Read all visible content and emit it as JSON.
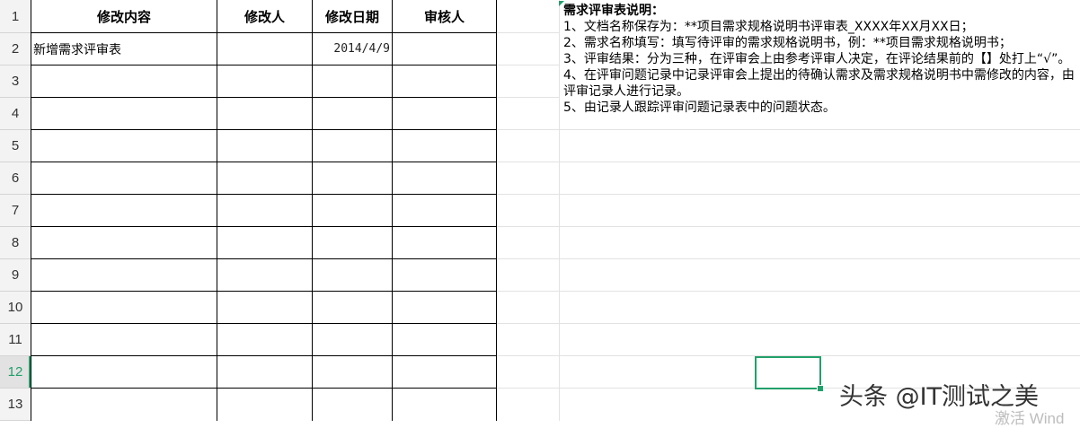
{
  "row_numbers": [
    "1",
    "2",
    "3",
    "4",
    "5",
    "6",
    "7",
    "8",
    "9",
    "10",
    "11",
    "12",
    "13"
  ],
  "active_row": "12",
  "table": {
    "headers": [
      "修改内容",
      "修改人",
      "修改日期",
      "审核人"
    ],
    "rows": [
      [
        "新增需求评审表",
        "",
        "2014/4/9",
        ""
      ]
    ]
  },
  "notes": {
    "title": "需求评审表说明：",
    "items": [
      "1、文档名称保存为：**项目需求规格说明书评审表_XXXX年XX月XX日；",
      "2、需求名称填写：填写待评审的需求规格说明书，例：**项目需求规格说明书；",
      "3、评审结果：分为三种，在评审会上由参考评审人决定，在评论结果前的【】处打上“√”。",
      "4、在评审问题记录中记录评审会上提出的待确认需求及需求规格说明书中需修改的内容，由评审记录人进行记录。",
      "5、由记录人跟踪评审问题记录表中的问题状态。"
    ]
  },
  "watermark": "头条 @IT测试之美",
  "activate_text": "激活 Wind",
  "colors": {
    "accent": "#22a06b",
    "grid": "#e2e2e2",
    "header_bg": "#f3f3f3"
  }
}
